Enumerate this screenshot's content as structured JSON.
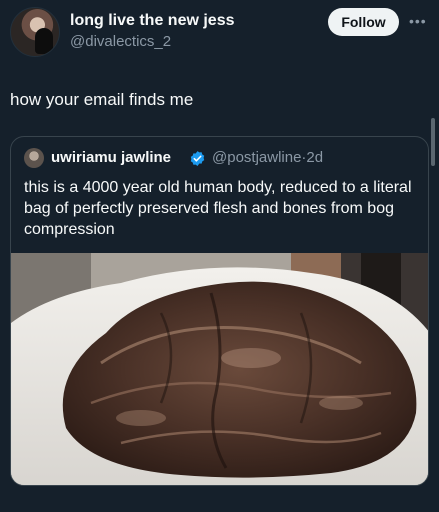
{
  "post": {
    "display_name": "long live the new jess",
    "handle": "@divalectics_2",
    "follow_label": "Follow",
    "more_icon": "more-horizontal-icon",
    "text": "how your email finds me"
  },
  "quoted_post": {
    "display_name": "uwiriamu jawline",
    "verified": true,
    "handle_time": "@postjawline·2d",
    "text": "this is a 4000 year old human body, reduced to a literal bag of perfectly preserved flesh and bones from bog compression",
    "media_description_icon": "photo"
  },
  "colors": {
    "background": "#15202b",
    "text_primary": "#f7f9f9",
    "text_secondary": "#8b98a5",
    "verified_blue": "#1d9bf0",
    "follow_button_bg": "#eff3f4",
    "border": "#38444d"
  }
}
